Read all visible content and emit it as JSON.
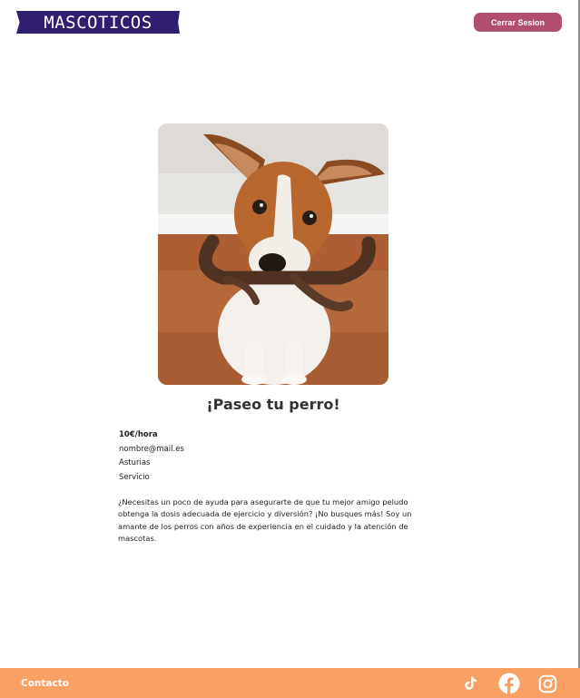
{
  "header": {
    "logo_text": "MASCOTICOS",
    "logout_label": "Cerrar Sesion"
  },
  "service": {
    "title": "¡Paseo tu perro!",
    "price": "10€/hora",
    "email": "nombre@mail.es",
    "location": "Asturias",
    "category": "Servicio",
    "description": "¿Necesitas un poco de ayuda para asegurarte de que tu mejor amigo peludo obtenga la dosis adecuada de ejercicio y diversión? ¡No busques más! Soy un amante de los perros con años de experiencia en el cuidado y la atención de mascotas."
  },
  "footer": {
    "contact_label": "Contacto",
    "social_icons": [
      "tiktok-icon",
      "facebook-icon",
      "instagram-icon"
    ]
  },
  "colors": {
    "brand": "#2f1f6e",
    "logout_button": "#b0506e",
    "footer": "#f9a064"
  }
}
